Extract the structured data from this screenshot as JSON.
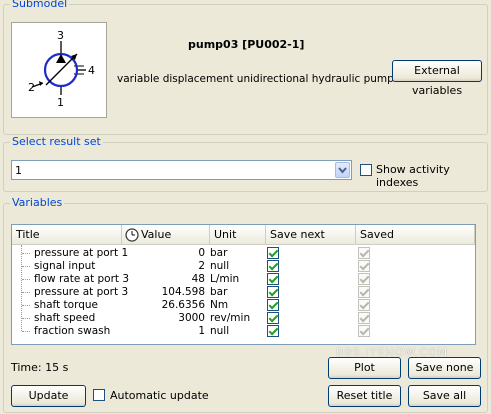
{
  "submodel": {
    "group_label": "Submodel",
    "icon_port_labels": [
      "3",
      "4",
      "2",
      "1"
    ],
    "name": "pump03 [PU002-1]",
    "description": "variable displacement unidirectional hydraulic pump",
    "external_variables_label": "External variables"
  },
  "result_set": {
    "group_label": "Select result set",
    "selected": "1",
    "show_activity_label": "Show activity indexes"
  },
  "variables": {
    "group_label": "Variables",
    "columns": [
      "Title",
      "Value",
      "Unit",
      "Save next",
      "Saved"
    ],
    "rows": [
      {
        "title": "pressure at port 1",
        "value": "0",
        "unit": "bar",
        "save_next": true,
        "saved": true
      },
      {
        "title": "signal input",
        "value": "2",
        "unit": "null",
        "save_next": true,
        "saved": true
      },
      {
        "title": "flow rate at port 3",
        "value": "48",
        "unit": "L/min",
        "save_next": true,
        "saved": true
      },
      {
        "title": "pressure at port 3",
        "value": "104.598",
        "unit": "bar",
        "save_next": true,
        "saved": true
      },
      {
        "title": "shaft torque",
        "value": "26.6356",
        "unit": "Nm",
        "save_next": true,
        "saved": true
      },
      {
        "title": "shaft speed",
        "value": "3000",
        "unit": "rev/min",
        "save_next": true,
        "saved": true
      },
      {
        "title": "fraction swash",
        "value": "1",
        "unit": "null",
        "save_next": true,
        "saved": true
      }
    ],
    "time_label": "Time: 15 s",
    "plot_label": "Plot",
    "save_none_label": "Save none",
    "update_label": "Update",
    "automatic_update_label": "Automatic update",
    "reset_title_label": "Reset title",
    "save_all_label": "Save all"
  },
  "watermark": "BBS.IYEHOW.COM"
}
